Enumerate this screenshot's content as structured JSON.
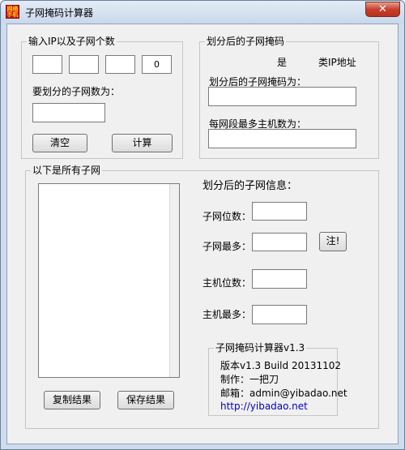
{
  "window": {
    "title": "子网掩码计算器",
    "icon_text": "网络手机",
    "close_glyph": "✕"
  },
  "ip_group": {
    "label": "输入IP以及子网个数",
    "octets": [
      "",
      "",
      "",
      "0"
    ],
    "subnet_count_label": "要划分的子网数为：",
    "subnet_count_value": "",
    "clear_label": "清空",
    "calc_label": "计算"
  },
  "mask_group": {
    "label": "划分后的子网掩码",
    "is_text": "是",
    "class_text": "类IP地址",
    "mask_label": "划分后的子网掩码为：",
    "mask_value": "",
    "hosts_label": "每网段最多主机数为：",
    "hosts_value": ""
  },
  "subnets_group": {
    "label": "以下是所有子网",
    "copy_label": "复制结果",
    "save_label": "保存结果"
  },
  "info": {
    "title": "划分后的子网信息：",
    "subnet_bits_label": "子网位数：",
    "subnet_max_label": "子网最多：",
    "note_label": "注!",
    "host_bits_label": "主机位数：",
    "host_max_label": "主机最多："
  },
  "about": {
    "label": "子网掩码计算器v1.3",
    "version": "版本v1.3   Build 20131102",
    "author": "制作：一把刀",
    "email": "邮箱：admin@yibadao.net",
    "url": "http://yibadao.net"
  },
  "colors": {
    "window_frame": "#cfdcec",
    "client_bg": "#f0f0f0",
    "close_button": "#c7402c",
    "link": "#0000cc"
  }
}
